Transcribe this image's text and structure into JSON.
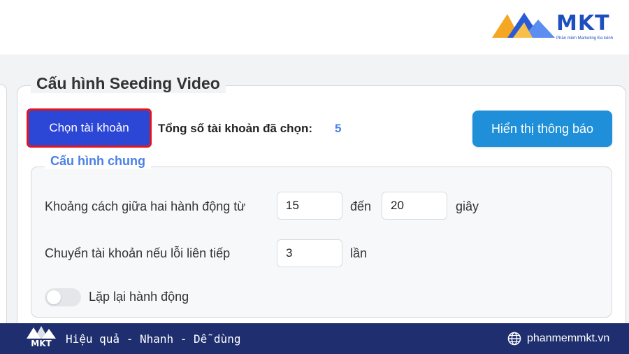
{
  "brand": {
    "name": "MKT",
    "tagline": "Phần mềm Marketing Đa kênh"
  },
  "panel": {
    "title": "Cấu hình Seeding Video",
    "choose_button": "Chọn tài khoản",
    "total_label": "Tổng số tài khoản đã chọn:",
    "total_count": "5",
    "notify_button": "Hiển thị thông báo"
  },
  "general": {
    "title": "Cấu hình chung",
    "interval_label": "Khoảng cách giữa hai hành động từ",
    "interval_from": "15",
    "interval_to_word": "đến",
    "interval_to": "20",
    "interval_unit": "giây",
    "switch_label": "Chuyển tài khoản nếu lỗi liên tiếp",
    "switch_value": "3",
    "switch_unit": "lần",
    "repeat_label": "Lặp lại hành động",
    "repeat_enabled": false
  },
  "footer": {
    "logo": "MKT",
    "slogan": "Hiệu quả - Nhanh - Dễ dùng",
    "website": "phanmemmkt.vn"
  },
  "colors": {
    "primary_button": "#2c46d6",
    "notify_button": "#1e8fd8",
    "highlight_outline": "#e0151c",
    "accent_text": "#4a80e8",
    "footer_bg": "#1e2e6e"
  }
}
